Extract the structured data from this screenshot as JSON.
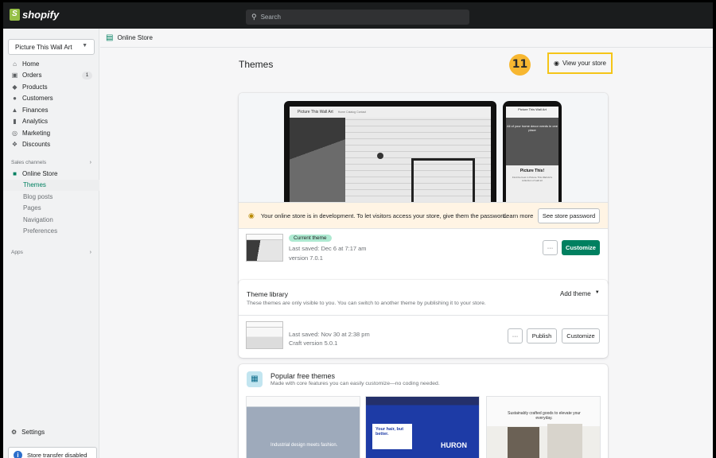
{
  "app": {
    "brand": "shopify"
  },
  "search": {
    "placeholder": "Search"
  },
  "sidebar": {
    "store_name": "Picture This Wall Art",
    "items": [
      {
        "label": "Home",
        "icon": "home-icon"
      },
      {
        "label": "Orders",
        "icon": "orders-icon",
        "badge": "1"
      },
      {
        "label": "Products",
        "icon": "tag-icon"
      },
      {
        "label": "Customers",
        "icon": "person-icon"
      },
      {
        "label": "Finances",
        "icon": "bank-icon"
      },
      {
        "label": "Analytics",
        "icon": "bar-chart-icon"
      },
      {
        "label": "Marketing",
        "icon": "target-icon"
      },
      {
        "label": "Discounts",
        "icon": "discount-icon"
      }
    ],
    "sales_channels_label": "Sales channels",
    "online_store_label": "Online Store",
    "sub_items": [
      "Themes",
      "Blog posts",
      "Pages",
      "Navigation",
      "Preferences"
    ],
    "apps_label": "Apps",
    "settings_label": "Settings",
    "transfer_label": "Store transfer disabled"
  },
  "breadcrumb": {
    "label": "Online Store"
  },
  "page": {
    "title": "Themes",
    "step_number": "11",
    "view_store_label": "View your store"
  },
  "current_theme": {
    "preview": {
      "tablet_topbar": "Home Decor Made Easy",
      "store_name": "Picture This Wall Art",
      "nav_links": "Home  Catalog  Contact",
      "phone_header": "Picture This Wall Art",
      "phone_hero": "All of your home decor needs in one place",
      "phone_title": "Picture This!",
      "phone_sub": "Find the best in Picture This Wall Art's collection of wall art"
    },
    "banner_text": "Your online store is in development. To let visitors access your store, give them the password.",
    "learn_more": "Learn more",
    "password_button": "See store password",
    "pill": "Current theme",
    "last_saved": "Last saved: Dec 6 at 7:17 am",
    "version": "version 7.0.1",
    "more_label": "···",
    "customize_label": "Customize"
  },
  "library": {
    "title": "Theme library",
    "description": "These themes are only visible to you. You can switch to another theme by publishing it to your store.",
    "add_theme_label": "Add theme",
    "last_saved": "Last saved: Nov 30 at 2:38 pm",
    "version": "Craft version 5.0.1",
    "more_label": "···",
    "publish_label": "Publish",
    "customize_label": "Customize"
  },
  "popular": {
    "title": "Popular free themes",
    "description": "Made with core features you can easily customize—no coding needed.",
    "thumb1_caption": "Industrial design meets fashion.",
    "thumb2_box": "Your hair, but better.",
    "thumb2_brand": "HURON",
    "thumb3_text": "Sustainably crafted goods to elevate your everyday."
  },
  "colors": {
    "accent": "#008060",
    "topbar": "#1a1c1d",
    "highlight": "#f5c518",
    "badge": "#f7b731"
  }
}
